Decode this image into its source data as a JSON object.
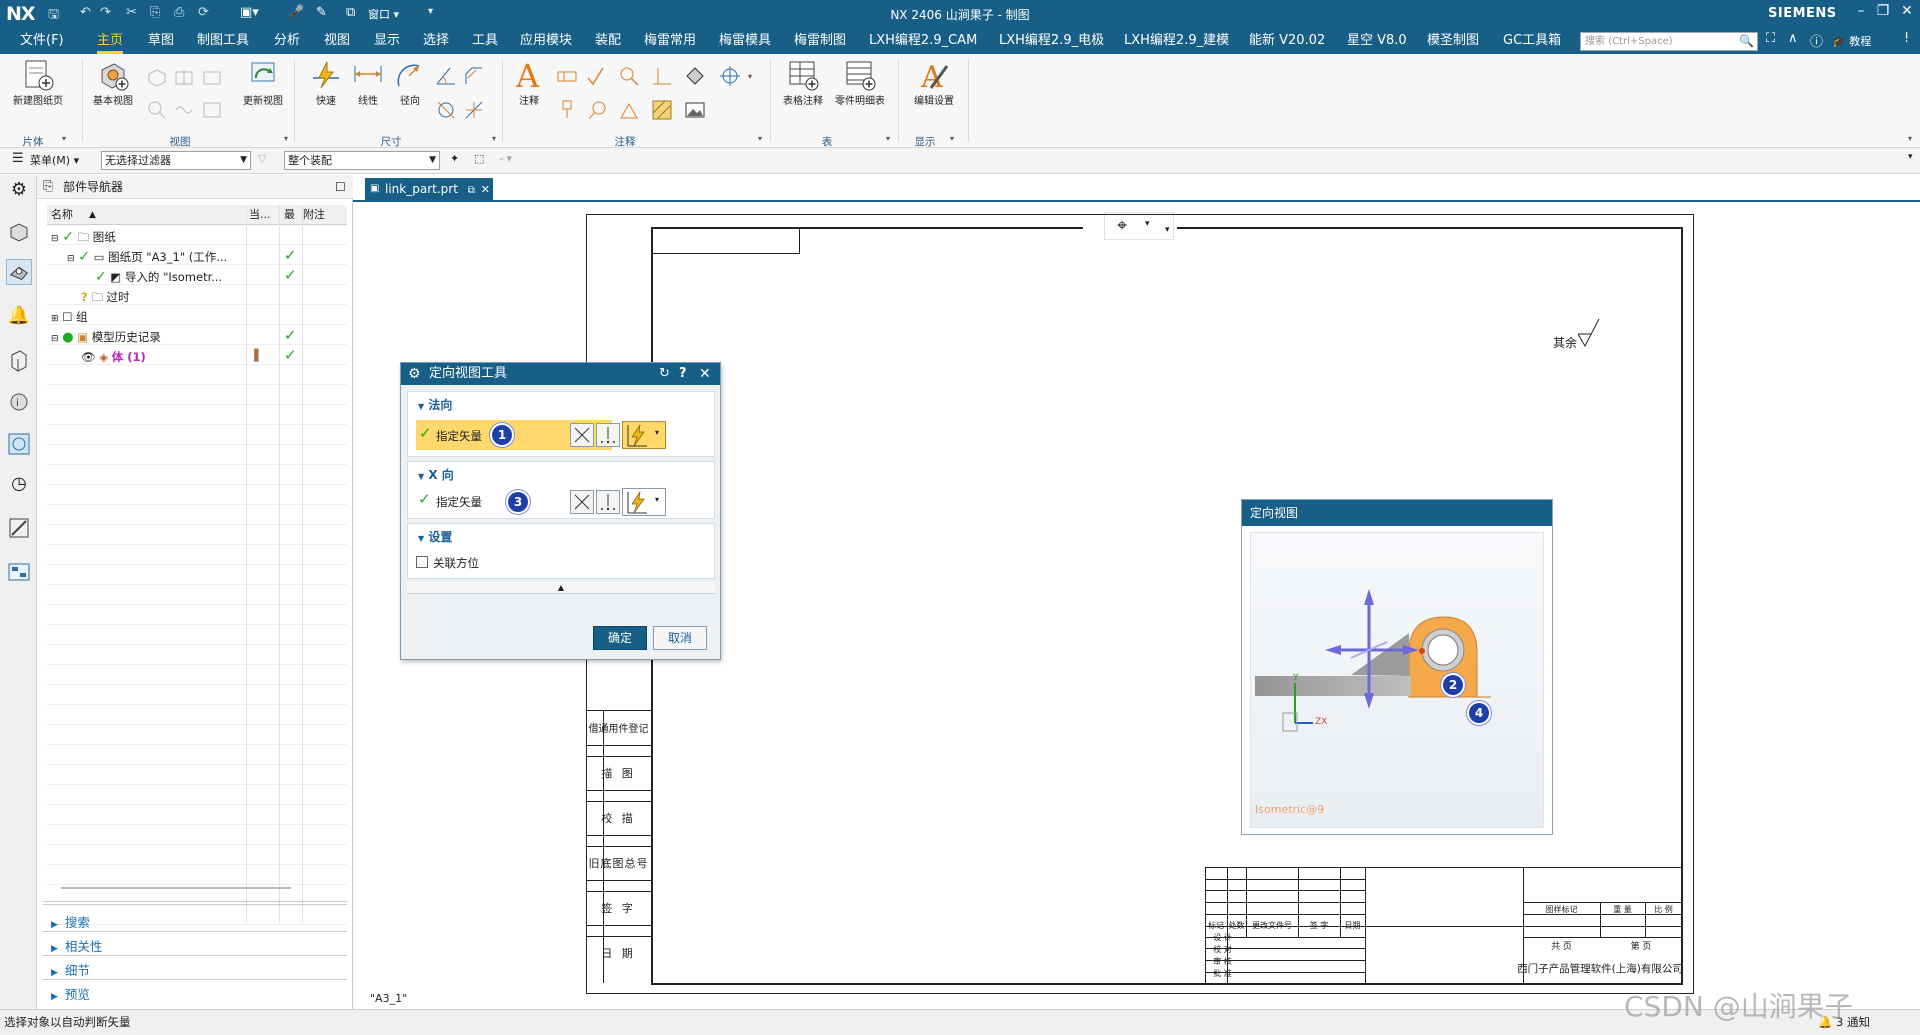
{
  "titlebar": {
    "logo": "NX",
    "title": "NX 2406 山涧果子 - 制图",
    "window_menu": "窗口",
    "brand": "SIEMENS"
  },
  "menubar": {
    "file": "文件(F)",
    "items": [
      "主页",
      "草图",
      "制图工具",
      "分析",
      "视图",
      "显示",
      "选择",
      "工具",
      "应用模块",
      "装配",
      "梅雷常用",
      "梅雷模具",
      "梅雷制图",
      "LXH编程2.9_CAM",
      "LXH编程2.9_电极",
      "LXH编程2.9_建模",
      "能新 V20.02",
      "星空 V8.0",
      "模圣制图",
      "GC工具箱"
    ],
    "active_index": 0,
    "search_placeholder": "搜索 (Ctrl+Space)",
    "tutorial": "教程"
  },
  "ribbon": {
    "new_sheet": "新建图纸页",
    "base_view": "基本视图",
    "update_view": "更新视图",
    "quick": "快速",
    "linear": "线性",
    "radial": "径向",
    "note": "注释",
    "table_note": "表格注释",
    "parts_list": "零件明细表",
    "edit_settings": "编辑设置",
    "groups": {
      "sheet": "片体",
      "view": "视图",
      "dimension": "尺寸",
      "annotation": "注释",
      "table": "表",
      "display": "显示"
    }
  },
  "toolbar2": {
    "menu": "菜单(M)",
    "filter": "无选择过滤器",
    "assembly": "整个装配"
  },
  "navigator": {
    "title": "部件导航器",
    "columns": [
      "名称",
      "当...",
      "最",
      "附注"
    ],
    "rows": [
      {
        "label": "图纸"
      },
      {
        "label": "图纸页 \"A3_1\" (工作..."
      },
      {
        "label": "导入的 \"Isometr..."
      },
      {
        "label": "过时"
      },
      {
        "label": "组"
      },
      {
        "label": "模型历史记录"
      },
      {
        "label": "体 (1)"
      }
    ],
    "bottom": [
      "搜索",
      "相关性",
      "细节",
      "预览"
    ]
  },
  "tab": {
    "label": "link_part.prt"
  },
  "sheet": {
    "name": "\"A3_1\"",
    "remark": "其余",
    "side_labels": [
      "借通用件登记",
      "描 图",
      "校 描",
      "旧底图总号",
      "签 字",
      "日 期"
    ],
    "titleblock": {
      "row_labels": [
        "标记",
        "处数",
        "更改文件号",
        "签 字",
        "日期"
      ],
      "left_labels": [
        "设 计",
        "校 对",
        "审 核",
        "批 准"
      ],
      "right_top": [
        "图样标记",
        "重 量",
        "比 例"
      ],
      "sheets": [
        "共 页",
        "第 页"
      ],
      "company": "西门子产品管理软件(上海)有限公司"
    }
  },
  "dialog": {
    "title": "定向视图工具",
    "section_normal": "法向",
    "section_x": "X 向",
    "section_settings": "设置",
    "specify_vector": "指定矢量",
    "associative": "关联方位",
    "ok": "确定",
    "cancel": "取消",
    "badges": [
      "1",
      "3"
    ]
  },
  "preview": {
    "title": "定向视图",
    "view_label": "Isometric@9",
    "badges": [
      "2",
      "4"
    ],
    "axis_y": "Y",
    "axis_zx": "ZX"
  },
  "status": {
    "message": "选择对象以自动判断矢量",
    "notifications": "3 通知"
  },
  "watermark": "CSDN @山涧果子",
  "colors": {
    "brand_bar": "#175f86",
    "active_tab": "#ffcc33",
    "highlight_row": "#ffd86b",
    "part_orange": "#f5a94a",
    "badge_blue": "#1f3fa8",
    "check_green": "#22aa22"
  }
}
